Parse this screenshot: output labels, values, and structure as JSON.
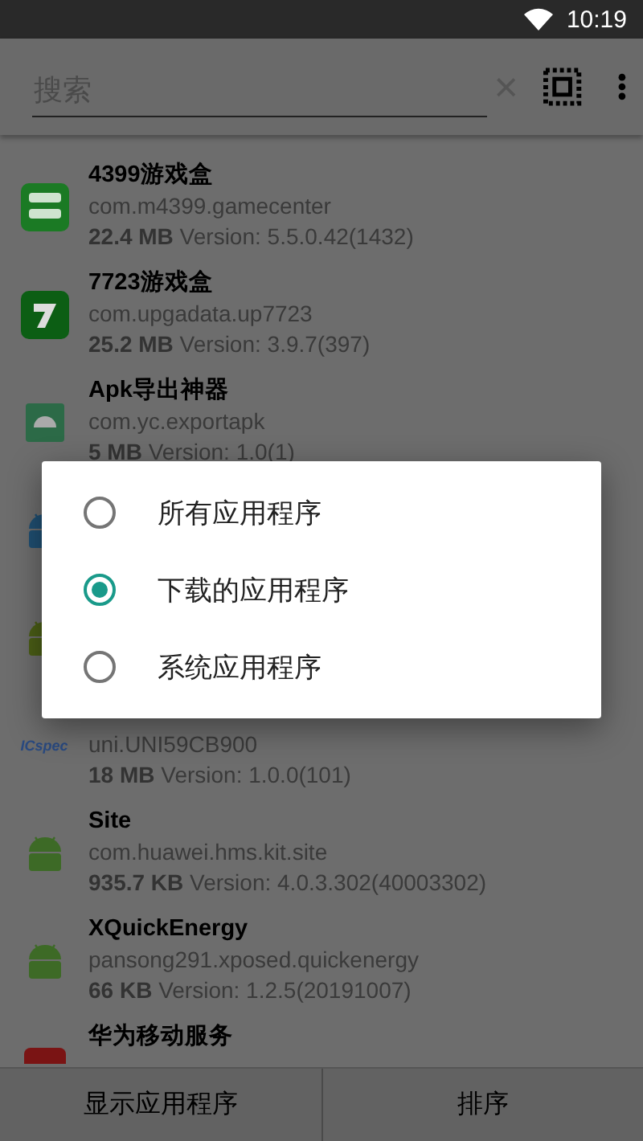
{
  "status_bar": {
    "time": "10:19"
  },
  "toolbar": {
    "search": {
      "placeholder": "搜索"
    },
    "clear_icon": "×"
  },
  "apps": [
    {
      "kind": "game-box",
      "title": "4399游戏盒",
      "package": "com.m4399.gamecenter",
      "info": "**22.4 MB** Version: 5.5.0.42(1432)"
    },
    {
      "kind": "seven",
      "title": "7723游戏盒",
      "package": "com.upgadata.up7723",
      "info": "**25.2 MB** Version: 3.9.7(397)"
    },
    {
      "kind": "android-tile",
      "title": "Apk导出神器",
      "package": "com.yc.exportapk",
      "info": "**5 MB** Version: 1.0(1)"
    },
    {
      "kind": "android-blue"
    },
    {
      "kind": "android-olive"
    },
    {
      "kind": "icspec",
      "icon_label": "ICspec",
      "package": "uni.UNI59CB900",
      "info": "**18 MB** Version: 1.0.0(101)"
    },
    {
      "kind": "android",
      "title": "Site",
      "package": "com.huawei.hms.kit.site",
      "info": "**935.7 KB** Version: 4.0.3.302(40003302)"
    },
    {
      "kind": "android",
      "title": "XQuickEnergy",
      "package": "pansong291.xposed.quickenergy",
      "info": "**66 KB** Version: 1.2.5(20191007)"
    },
    {
      "kind": "huawei",
      "title": "华为移动服务"
    }
  ],
  "dialog": {
    "options": [
      {
        "label": "所有应用程序",
        "selected": false
      },
      {
        "label": "下载的应用程序",
        "selected": true
      },
      {
        "label": "系统应用程序",
        "selected": false
      }
    ]
  },
  "bottom_bar": {
    "buttons": [
      "显示应用程序",
      "排序"
    ]
  }
}
